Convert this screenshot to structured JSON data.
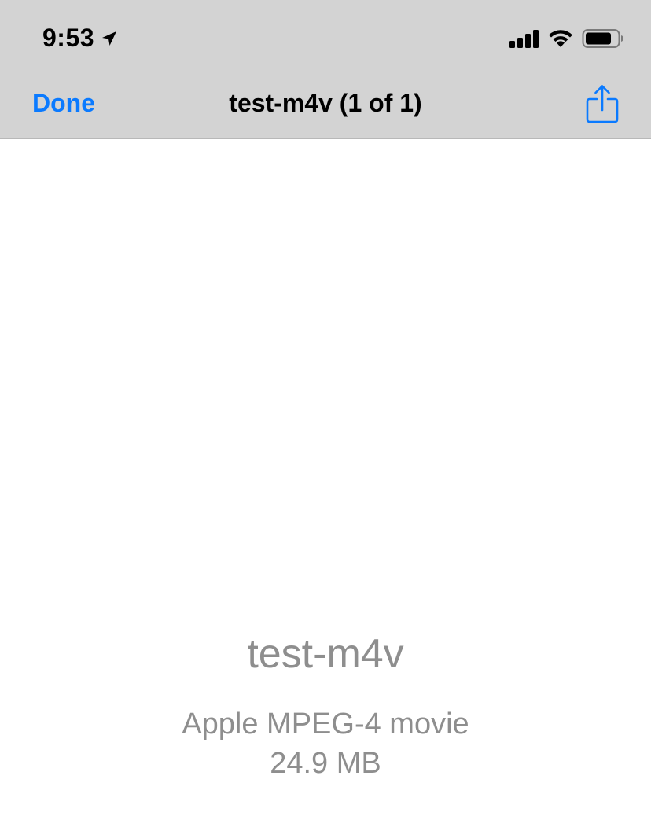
{
  "status_bar": {
    "time": "9:53",
    "icons": [
      "location-arrow-icon",
      "cellular-signal-icon",
      "wifi-icon",
      "battery-icon"
    ]
  },
  "nav_bar": {
    "done_label": "Done",
    "title": "test-m4v (1 of 1)",
    "share_icon": "share-icon",
    "accent_color": "#0a7aff"
  },
  "file_info": {
    "name": "test-m4v",
    "kind": "Apple MPEG-4 movie",
    "size": "24.9 MB"
  }
}
